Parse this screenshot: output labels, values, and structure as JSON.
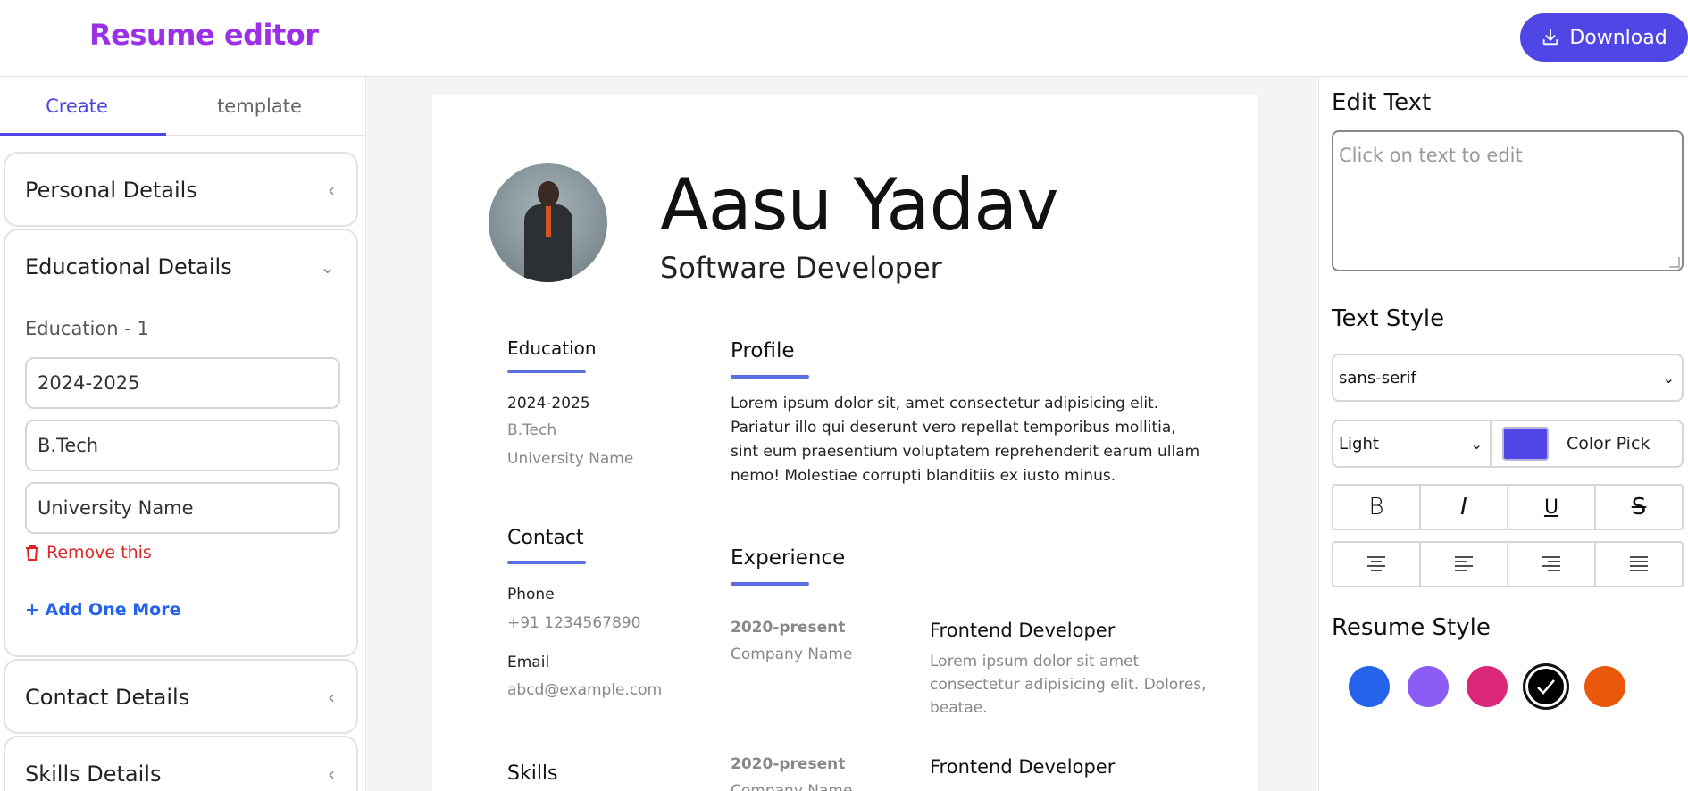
{
  "header": {
    "title": "Resume editor",
    "download_label": "Download"
  },
  "sidebar": {
    "tabs": [
      {
        "label": "Create",
        "active": true
      },
      {
        "label": "template",
        "active": false
      }
    ],
    "sections": {
      "personal": "Personal Details",
      "educational": "Educational Details",
      "contact": "Contact Details",
      "skills": "Skills Details"
    },
    "education": {
      "label": "Education - 1",
      "year": "2024-2025",
      "degree": "B.Tech",
      "university": "University Name",
      "remove_label": "Remove this",
      "add_label": "+ Add One More"
    }
  },
  "resume": {
    "name": "Aasu Yadav",
    "role": "Software Developer",
    "education": {
      "title": "Education",
      "year": "2024-2025",
      "degree": "B.Tech",
      "university": "University Name"
    },
    "contact": {
      "title": "Contact",
      "phone_label": "Phone",
      "phone": "+91 1234567890",
      "email_label": "Email",
      "email": "abcd@example.com"
    },
    "skills_title": "Skills",
    "profile": {
      "title": "Profile",
      "lines": [
        "Lorem ipsum dolor sit, amet consectetur adipisicing elit.",
        "Pariatur illo qui deserunt vero repellat temporibus mollitia,",
        "sint eum praesentium voluptatem reprehenderit earum ullam",
        "nemo! Molestiae corrupti blanditiis ex iusto minus."
      ]
    },
    "experience": {
      "title": "Experience",
      "items": [
        {
          "period": "2020-present",
          "company": "Company Name",
          "job": "Frontend Developer",
          "desc_lines": [
            "Lorem ipsum dolor sit amet",
            "consectetur adipisicing elit. Dolores,",
            "beatae."
          ]
        },
        {
          "period": "2020-present",
          "company": "Company Name",
          "job": "Frontend Developer"
        }
      ]
    }
  },
  "panel": {
    "edit_text_title": "Edit Text",
    "edit_placeholder": "Click on text to edit",
    "text_style_title": "Text Style",
    "font_family": "sans-serif",
    "font_weight": "Light",
    "color_pick_label": "Color Pick",
    "accent_color": "#4f46e5",
    "format_buttons": [
      "B",
      "I",
      "U",
      "S"
    ],
    "align_icons": [
      "align-center-icon",
      "align-left-icon",
      "align-right-icon",
      "align-justify-icon"
    ],
    "resume_style_title": "Resume Style",
    "style_colors": [
      "#2563eb",
      "#8b5cf6",
      "#db2777",
      "#000000",
      "#ea580c"
    ],
    "selected_style_index": 3
  }
}
